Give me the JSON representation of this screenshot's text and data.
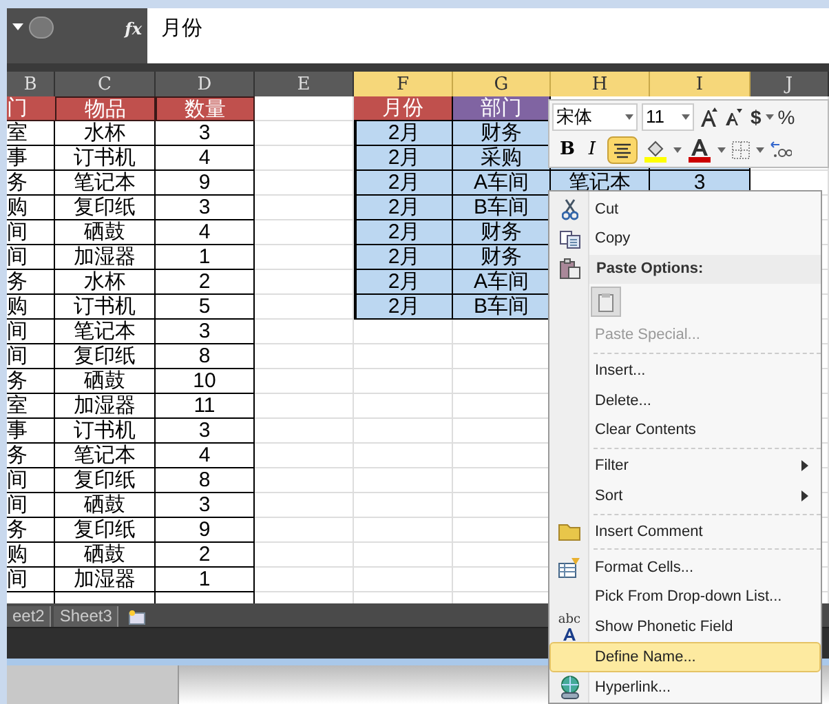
{
  "formula_bar": {
    "function_label": "fx",
    "value": "月份"
  },
  "columns": [
    {
      "label": "B",
      "selected": false
    },
    {
      "label": "C",
      "selected": false
    },
    {
      "label": "D",
      "selected": false
    },
    {
      "label": "E",
      "selected": false
    },
    {
      "label": "F",
      "selected": true
    },
    {
      "label": "G",
      "selected": true
    },
    {
      "label": "H",
      "selected": true
    },
    {
      "label": "I",
      "selected": true
    },
    {
      "label": "J",
      "selected": false
    }
  ],
  "left_table": {
    "header": [
      "门",
      "物品",
      "数量"
    ],
    "rows": [
      [
        "室",
        "水杯",
        "3"
      ],
      [
        "事",
        "订书机",
        "4"
      ],
      [
        "务",
        "笔记本",
        "9"
      ],
      [
        "购",
        "复印纸",
        "3"
      ],
      [
        "间",
        "硒鼓",
        "4"
      ],
      [
        "间",
        "加湿器",
        "1"
      ],
      [
        "务",
        "水杯",
        "2"
      ],
      [
        "购",
        "订书机",
        "5"
      ],
      [
        "间",
        "笔记本",
        "3"
      ],
      [
        "间",
        "复印纸",
        "8"
      ],
      [
        "务",
        "硒鼓",
        "10"
      ],
      [
        "室",
        "加湿器",
        "11"
      ],
      [
        "事",
        "订书机",
        "3"
      ],
      [
        "务",
        "笔记本",
        "4"
      ],
      [
        "间",
        "复印纸",
        "8"
      ],
      [
        "间",
        "硒鼓",
        "3"
      ],
      [
        "务",
        "复印纸",
        "9"
      ],
      [
        "购",
        "硒鼓",
        "2"
      ],
      [
        "间",
        "加湿器",
        "1"
      ]
    ]
  },
  "right_table": {
    "header": [
      "月份",
      "部门"
    ],
    "rows": [
      {
        "cells": [
          "2月",
          "财务"
        ],
        "selected": true
      },
      {
        "cells": [
          "2月",
          "采购"
        ],
        "selected": true
      },
      {
        "cells": [
          "2月",
          "A车间",
          "笔记本",
          "3"
        ],
        "selected": true
      },
      {
        "cells": [
          "2月",
          "B车间"
        ],
        "selected": true
      },
      {
        "cells": [
          "2月",
          "财务"
        ],
        "selected": true
      },
      {
        "cells": [
          "2月",
          "财务"
        ],
        "selected": true
      },
      {
        "cells": [
          "2月",
          "A车间"
        ],
        "selected": true
      },
      {
        "cells": [
          "2月",
          "B车间"
        ],
        "selected": true
      }
    ]
  },
  "mini_toolbar": {
    "font": "宋体",
    "size": "11",
    "currency": "$",
    "percent": "%",
    "bold": "B",
    "italic": "I",
    "center_align_on": true
  },
  "context_menu": [
    {
      "kind": "item",
      "label": "Cut",
      "selected": false,
      "disabled": false
    },
    {
      "kind": "item",
      "label": "Copy",
      "selected": false,
      "disabled": false
    },
    {
      "kind": "header",
      "label": "Paste Options:"
    },
    {
      "kind": "paste"
    },
    {
      "kind": "item",
      "label": "Paste Special...",
      "selected": false,
      "disabled": true
    },
    {
      "kind": "separator"
    },
    {
      "kind": "item",
      "label": "Insert...",
      "selected": false,
      "disabled": false
    },
    {
      "kind": "item",
      "label": "Delete...",
      "selected": false,
      "disabled": false
    },
    {
      "kind": "item",
      "label": "Clear Contents",
      "selected": false,
      "disabled": false
    },
    {
      "kind": "separator"
    },
    {
      "kind": "submenu",
      "label": "Filter",
      "selected": false,
      "disabled": false
    },
    {
      "kind": "submenu",
      "label": "Sort",
      "selected": false,
      "disabled": false
    },
    {
      "kind": "separator"
    },
    {
      "kind": "item",
      "label": "Insert Comment",
      "selected": false,
      "disabled": false
    },
    {
      "kind": "separator"
    },
    {
      "kind": "item",
      "label": "Format Cells...",
      "selected": false,
      "disabled": false
    },
    {
      "kind": "item",
      "label": "Pick From Drop-down List...",
      "selected": false,
      "disabled": false
    },
    {
      "kind": "item",
      "label": "Show Phonetic Field",
      "icon_text": "abc",
      "selected": false,
      "disabled": false
    },
    {
      "kind": "item",
      "label": "Define Name...",
      "selected": true,
      "disabled": false
    },
    {
      "kind": "item",
      "label": "Hyperlink...",
      "selected": false,
      "disabled": false
    }
  ],
  "sheet_tabs": [
    "eet2",
    "Sheet3"
  ]
}
